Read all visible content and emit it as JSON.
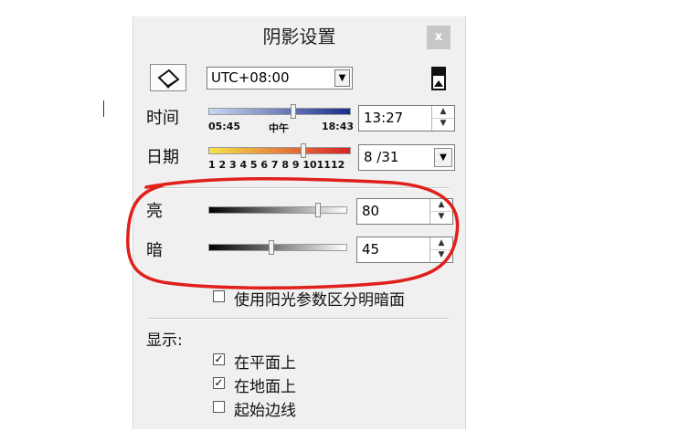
{
  "dialog": {
    "title": "阴影设置",
    "close_label": "x"
  },
  "timezone": {
    "value": "UTC+08:00"
  },
  "time": {
    "label": "时间",
    "start": "05:45",
    "noon": "中午",
    "end": "18:43",
    "value": "13:27"
  },
  "date": {
    "label": "日期",
    "months": "1 2 3 4 5 6 7 8 9 101112",
    "value": "8 /31"
  },
  "light": {
    "label": "亮",
    "value": "80",
    "level_percent": 80
  },
  "dark": {
    "label": "暗",
    "value": "45",
    "level_percent": 45
  },
  "sun_option": {
    "label": "使用阳光参数区分明暗面"
  },
  "display": {
    "label": "显示:",
    "options": [
      {
        "label": "在平面上",
        "checked": true
      },
      {
        "label": "在地面上",
        "checked": true
      },
      {
        "label": "起始边线",
        "checked": false
      }
    ]
  },
  "colors": {
    "annotation": "#e0201a",
    "time_bar_start": "#c9d8ef",
    "time_bar_end": "#1a2d8a",
    "date_bar_start": "#f7e24a",
    "date_bar_end": "#d8222a"
  }
}
